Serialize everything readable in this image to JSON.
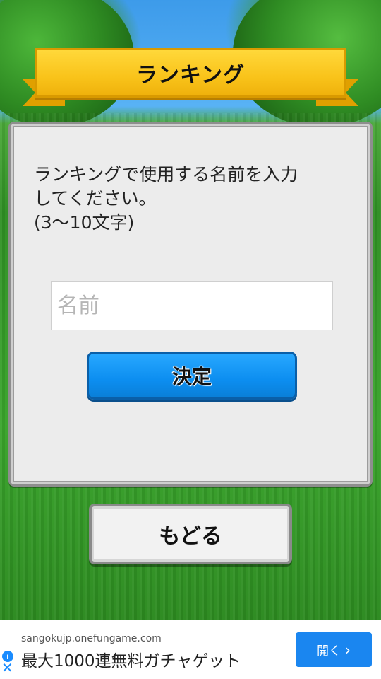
{
  "title": {
    "text": "ランキング"
  },
  "panel": {
    "instruction_lines": [
      "ランキングで使用する名前を入力",
      "してください。",
      "(3〜10文字)"
    ],
    "name_input": {
      "placeholder": "名前",
      "value": ""
    },
    "confirm_label": "決定"
  },
  "back_label": "もどる",
  "ad": {
    "domain": "sangokujp.onefungame.com",
    "headline": "最大1000連無料ガチャゲット",
    "open_label": "開く",
    "open_chevron": "›",
    "info_icon_glyph": "i",
    "close_icon_glyph": "✕"
  },
  "colors": {
    "banner_yellow": "#f9c31a",
    "confirm_blue": "#0c8ef0",
    "ad_blue": "#1a86f0"
  }
}
